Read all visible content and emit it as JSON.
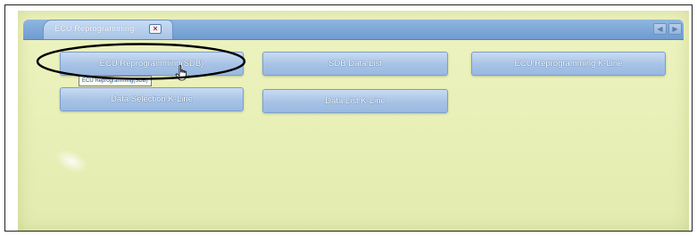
{
  "tab": {
    "label": "ECU Reprogramming",
    "close_glyph": "×"
  },
  "nav": {
    "prev_glyph": "◀",
    "next_glyph": "▶"
  },
  "buttons": [
    {
      "label": "ECU Reprogramming(SDB)"
    },
    {
      "label": "SDB Data List"
    },
    {
      "label": "ECU Reprogramming.K-Line"
    },
    {
      "label": "Data Selection.K-Line"
    },
    {
      "label": "Data List.K-Line"
    }
  ],
  "tooltip": {
    "text": "ECU Reprogramming(SDB)"
  },
  "icons": {
    "cursor": "hand-pointer-icon"
  },
  "colors": {
    "background": "#e9f0b8",
    "tabbar": "#7ba5d8",
    "button": "#a6c2e6",
    "annotation": "#000000"
  }
}
